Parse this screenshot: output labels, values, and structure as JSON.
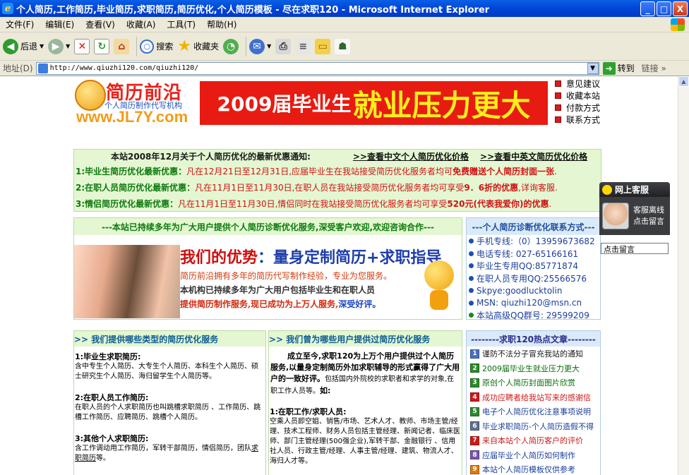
{
  "window": {
    "title": "个人简历,工作简历,毕业简历,求职简历,简历优化,个人简历模板 - 尽在求职120 - Microsoft Internet Explorer",
    "minimize": "_",
    "maximize": "□",
    "close": "X"
  },
  "menu": [
    "文件(F)",
    "编辑(E)",
    "查看(V)",
    "收藏(A)",
    "工具(T)",
    "帮助(H)"
  ],
  "toolbar": {
    "back": "后退",
    "search": "搜索",
    "favorites": "收藏夹"
  },
  "address": {
    "label": "地址(D)",
    "url": "http://www.qiuzhi120.com/qiuzhi120/",
    "go": "转到",
    "links": "链接"
  },
  "header": {
    "logo_name": "简历前沿",
    "logo_tag": "个人简历制作代写机构",
    "logo_url": "www.JL7Y.com",
    "banner_part1": "2009届毕业生",
    "banner_part2": "就业压力更大",
    "right_links": [
      "意见建议",
      "收藏本站",
      "付款方式",
      "联系方式"
    ]
  },
  "notice": {
    "title": "本站2008年12月关于个人简历优化的最新优惠通知:",
    "link1": ">>查看中文个人简历优化价格",
    "link2": ">>查看中英文简历优化价格",
    "lines": [
      {
        "label": "1:毕业生简历优化最新优惠：",
        "text": "凡在12月21日至12月31日,应届毕业生在我站接受简历优化服务者均可",
        "emph": "免费赠送个人简历封面一张",
        "tail": "."
      },
      {
        "label": "2:在职人员简历优化最新优惠：",
        "text": "凡在11月1日至11月30日,在职人员在我站接受简历优化服务者均可享受",
        "emph": "9．6折的优惠",
        "tail": ",详询客服."
      },
      {
        "label": "3:情侣简历优化最新优惠：",
        "text": "凡在11月1日至11月30日,情侣同时在我站接受简历优化服务者均可享受",
        "emph": "520元(代表我爱你)的优惠",
        "tail": "."
      }
    ]
  },
  "advantage": {
    "header": "---本站已持续多年为广大用户提供个人简历诊断优化服务,深受客户欢迎,欢迎咨询合作---",
    "title_a": "我们的优势",
    "title_b": "：量身定制简历",
    "title_c": "+求职指导",
    "p1": "简历前沿拥有多年的简历代写制作经验，专业为您服务。",
    "p2": "本机构已持续多年为广大用户包括毕业生和在职人员",
    "p3a": "提供简历制作服务,现已成功为上万人服务,",
    "p3b": "深受好评。"
  },
  "contact": {
    "header": "---个人简历诊断优化联系方式---",
    "items": [
      "手机专线:（0）13959673682",
      "电话专线: 027-65166161",
      "毕业生专用QQ:85771874",
      "在职人员专用QQ:25566576",
      "Skpye:goodlucktolin",
      "MSN: qiuzhi120@msn.cn",
      "本站高级QQ群号: 29599209"
    ]
  },
  "services": {
    "header": ">> 我们提供哪些类型的简历优化服务",
    "s1_title": "1:毕业生求职简历:",
    "s1_text": "含中专生个人简历、大专生个人简历、本科生个人简历、硕士研究生个人简历、海归留学生个人简历等。",
    "s2_title": "2:在职人员工作简历:",
    "s2_text": "在职人员的个人求职简历也叫跳槽求职简历 、工作简历、跳槽工作简历、应聘简历、跳槽个人简历。",
    "s3_title": "3:其他个人求职简历:",
    "s3_text_a": "含工作调动用工作简历，军转干部简历，情侣简历，团队",
    "s3_text_b": "求职简历",
    "s3_text_c": "等。"
  },
  "served": {
    "header": ">> 我们曾为哪些用户提供过简历优化服务",
    "intro_bold": "成立至今,求职120为上万个用户提供过个人简历服务,以量身定制简历外加求职辅导的形式赢得了广大用户的一致好评。",
    "intro_normal": "包括国内外院校的求职者和求学的对象,在职工作人员等。",
    "intro_tail": "如:",
    "c1_title": "1:在职工作/求职人员:",
    "c1_text": "空乘人员即空姐、销售/市场、艺术人才、教师、市场主管/经理、技术工程师、财务人员包括主管经理、新闻记者、临床医师、部门主管经理(500强企业),军转干部、金融银行 、信用社人员、行政主管/经理、人事主管/经理、建筑、物流人才、海归人才等。"
  },
  "hot": {
    "header": "--------求职120热点文章--------",
    "items": [
      {
        "num": "1",
        "text": "谨防不法分子冒充我站的通知",
        "color": "#1a1a1a",
        "bg": "#4a6fc2"
      },
      {
        "num": "2",
        "text": "2009届毕业生就业压力更大",
        "color": "#0b6d0b",
        "bg": "#2c8a2c"
      },
      {
        "num": "3",
        "text": "原创个人简历封面图片欣赏",
        "color": "#0b6d0b",
        "bg": "#2c8a2c"
      },
      {
        "num": "4",
        "text": "成功应聘者给我站写来的感谢信",
        "color": "#cc1a1a",
        "bg": "#cc1a1a"
      },
      {
        "num": "5",
        "text": "电子个人简历优化注意事项说明",
        "color": "#1a3e9b",
        "bg": "#2c8a2c"
      },
      {
        "num": "6",
        "text": "毕业求职简历-个人简历造假不得",
        "color": "#1a3e9b",
        "bg": "#5f6f8f"
      },
      {
        "num": "7",
        "text": "来自本站个人简历客户的评价",
        "color": "#cc1a1a",
        "bg": "#cc1a1a"
      },
      {
        "num": "8",
        "text": "应届毕业个人简历如何制作",
        "color": "#1a3e9b",
        "bg": "#7a55b0"
      },
      {
        "num": "9",
        "text": "本站个人简历模板仅供参考",
        "color": "#1a3e9b",
        "bg": "#e07a10"
      }
    ]
  },
  "service_widget": {
    "title": "网上客服",
    "line1": "客服离线",
    "line2": "点击留言",
    "msg": "点击留言"
  },
  "colors": {
    "accent_red": "#e71b12",
    "accent_green": "#0c7a0c",
    "panel_green": "#e4f7d2",
    "panel_blue": "#dbeaf8",
    "titlebar_blue": "#0048d8"
  }
}
